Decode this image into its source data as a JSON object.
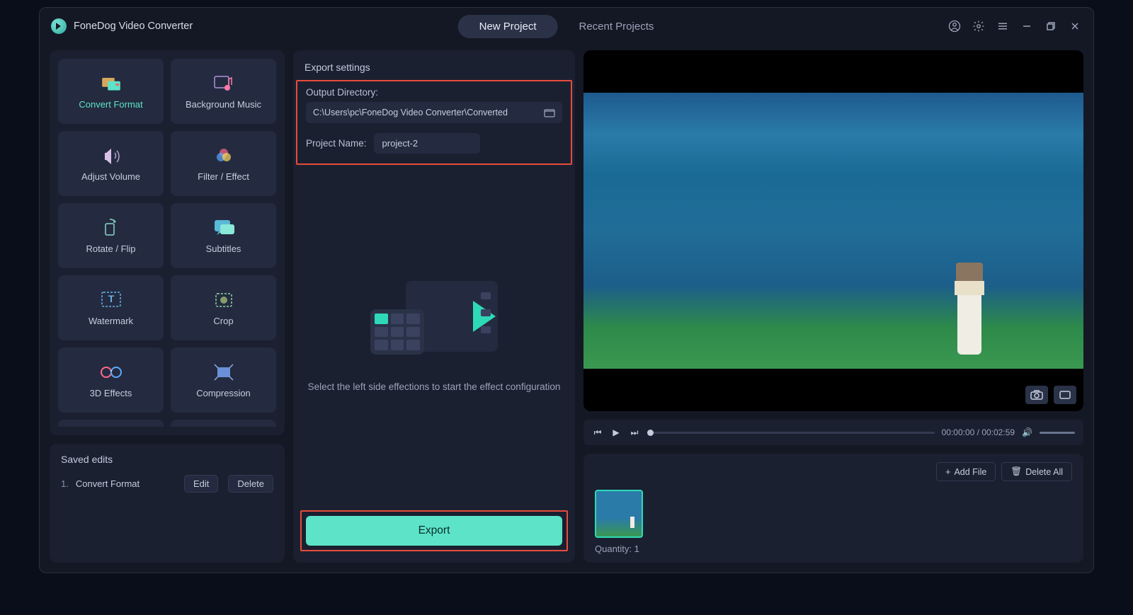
{
  "app": {
    "title": "FoneDog Video Converter"
  },
  "tabs": {
    "new": "New Project",
    "recent": "Recent Projects"
  },
  "tools": {
    "convert": "Convert Format",
    "bgmusic": "Background Music",
    "volume": "Adjust Volume",
    "filter": "Filter / Effect",
    "rotate": "Rotate / Flip",
    "subtitles": "Subtitles",
    "watermark": "Watermark",
    "crop": "Crop",
    "3d": "3D Effects",
    "compress": "Compression"
  },
  "saved": {
    "title": "Saved edits",
    "items": [
      {
        "num": "1.",
        "name": "Convert Format"
      }
    ],
    "edit": "Edit",
    "delete": "Delete"
  },
  "export": {
    "title": "Export settings",
    "dir_label": "Output Directory:",
    "dir_value": "C:\\Users\\pc\\FoneDog Video Converter\\Converted",
    "name_label": "Project Name:",
    "name_value": "project-2",
    "placeholder": "Select the left side effections to start the effect configuration",
    "button": "Export"
  },
  "player": {
    "time_current": "00:00:00",
    "time_total": "00:02:59"
  },
  "files": {
    "add": "Add File",
    "delete_all": "Delete All",
    "quantity_label": "Quantity:",
    "quantity_value": "1"
  }
}
